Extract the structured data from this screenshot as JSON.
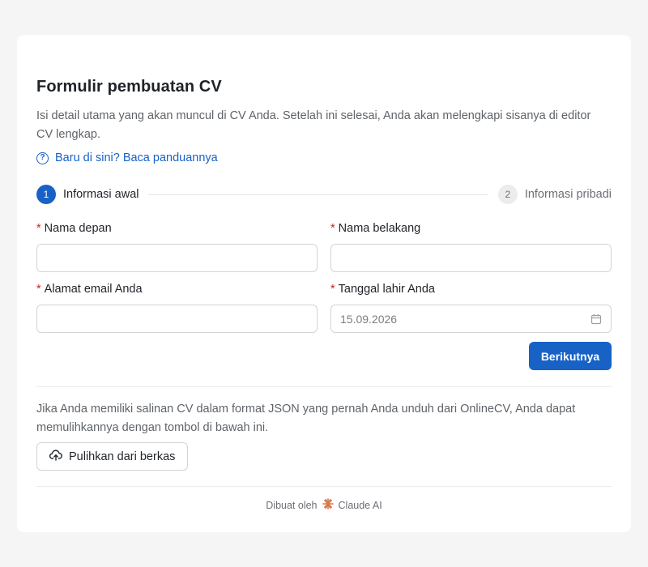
{
  "form": {
    "title": "Formulir pembuatan CV",
    "subtitle": "Isi detail utama yang akan muncul di CV Anda. Setelah ini selesai, Anda akan melengkapi sisanya di editor CV lengkap.",
    "guide_link": "Baru di sini? Baca panduannya"
  },
  "stepper": {
    "steps": [
      {
        "num": "1",
        "label": "Informasi awal",
        "state": "active"
      },
      {
        "num": "2",
        "label": "Informasi pribadi",
        "state": "inactive"
      }
    ]
  },
  "fields": {
    "required_mark": "*",
    "first_name": {
      "label": "Nama depan",
      "value": ""
    },
    "last_name": {
      "label": "Nama belakang",
      "value": ""
    },
    "email": {
      "label": "Alamat email Anda",
      "value": ""
    },
    "birthdate": {
      "label": "Tanggal lahir Anda",
      "value": "15.09.2026"
    }
  },
  "actions": {
    "next_label": "Berikutnya"
  },
  "restore": {
    "text": "Jika Anda memiliki salinan CV dalam format JSON yang pernah Anda unduh dari OnlineCV, Anda dapat memulihkannya dengan tombol di bawah ini.",
    "button_label": "Pulihkan dari berkas"
  },
  "footer": {
    "prefix": "Dibuat oleh",
    "brand": "Claude AI"
  },
  "icons": {
    "help": "question-circle-icon",
    "calendar": "calendar-icon",
    "upload": "cloud-upload-icon",
    "brand": "claude-sunburst-icon"
  },
  "colors": {
    "accent": "#1862c6",
    "required": "#c4261d",
    "brand_icon": "#d9774b"
  }
}
